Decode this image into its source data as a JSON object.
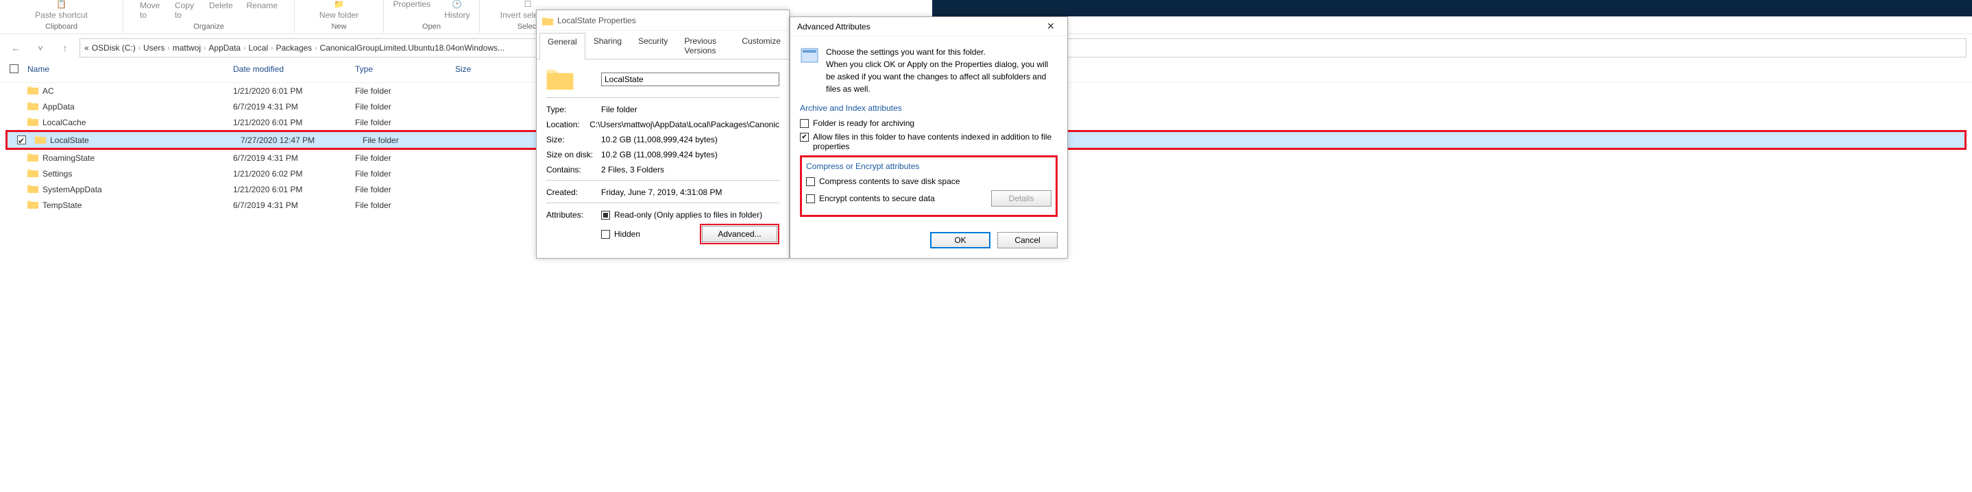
{
  "ribbon": {
    "paste_shortcut": "Paste shortcut",
    "move_to": "Move to",
    "copy_to": "Copy to",
    "delete": "Delete",
    "rename": "Rename",
    "new_folder": "New folder",
    "properties": "Properties",
    "history": "History",
    "invert_selection": "Invert selection",
    "groups": {
      "clipboard": "Clipboard",
      "organize": "Organize",
      "new": "New",
      "open": "Open",
      "select": "Select"
    }
  },
  "breadcrumb": [
    "«",
    "OSDisk (C:)",
    "Users",
    "mattwoj",
    "AppData",
    "Local",
    "Packages",
    "CanonicalGroupLimited.Ubuntu18.04onWindows..."
  ],
  "columns": {
    "name": "Name",
    "modified": "Date modified",
    "type": "Type",
    "size": "Size"
  },
  "files": [
    {
      "name": "AC",
      "date": "1/21/2020 6:01 PM",
      "type": "File folder"
    },
    {
      "name": "AppData",
      "date": "6/7/2019 4:31 PM",
      "type": "File folder"
    },
    {
      "name": "LocalCache",
      "date": "1/21/2020 6:01 PM",
      "type": "File folder"
    },
    {
      "name": "LocalState",
      "date": "7/27/2020 12:47 PM",
      "type": "File folder",
      "selected": true,
      "highlight": true
    },
    {
      "name": "RoamingState",
      "date": "6/7/2019 4:31 PM",
      "type": "File folder"
    },
    {
      "name": "Settings",
      "date": "1/21/2020 6:02 PM",
      "type": "File folder"
    },
    {
      "name": "SystemAppData",
      "date": "1/21/2020 6:01 PM",
      "type": "File folder"
    },
    {
      "name": "TempState",
      "date": "6/7/2019 4:31 PM",
      "type": "File folder"
    }
  ],
  "props": {
    "title": "LocalState Properties",
    "tabs": [
      "General",
      "Sharing",
      "Security",
      "Previous Versions",
      "Customize"
    ],
    "name_value": "LocalState",
    "type_label": "Type:",
    "type_value": "File folder",
    "location_label": "Location:",
    "location_value": "C:\\Users\\mattwoj\\AppData\\Local\\Packages\\Canonic",
    "size_label": "Size:",
    "size_value": "10.2 GB (11,008,999,424 bytes)",
    "disk_label": "Size on disk:",
    "disk_value": "10.2 GB (11,008,999,424 bytes)",
    "contains_label": "Contains:",
    "contains_value": "2 Files, 3 Folders",
    "created_label": "Created:",
    "created_value": "Friday, June 7, 2019, 4:31:08 PM",
    "attributes_label": "Attributes:",
    "readonly_label": "Read-only (Only applies to files in folder)",
    "hidden_label": "Hidden",
    "advanced_btn": "Advanced..."
  },
  "adv": {
    "title": "Advanced Attributes",
    "intro1": "Choose the settings you want for this folder.",
    "intro2": "When you click OK or Apply on the Properties dialog, you will be asked if you want the changes to affect all subfolders and files as well.",
    "archive_group": "Archive and Index attributes",
    "archive_ready": "Folder is ready for archiving",
    "allow_index": "Allow files in this folder to have contents indexed in addition to file properties",
    "compress_group": "Compress or Encrypt attributes",
    "compress_label": "Compress contents to save disk space",
    "encrypt_label": "Encrypt contents to secure data",
    "details_btn": "Details",
    "ok_btn": "OK",
    "cancel_btn": "Cancel"
  }
}
